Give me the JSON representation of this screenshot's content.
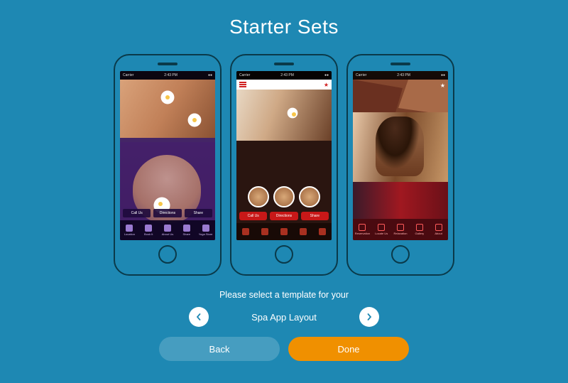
{
  "title": "Starter Sets",
  "instruction": "Please select a template for your",
  "templateName": "Spa App Layout",
  "buttons": {
    "back": "Back",
    "done": "Done"
  },
  "status": {
    "carrier": "Carrier",
    "time": "2:43 PM"
  },
  "phone1": {
    "actions": [
      "Call Us",
      "Directions",
      "Share"
    ],
    "tabs": [
      "Location",
      "Book It",
      "About Us",
      "Share",
      "Yoga Store"
    ]
  },
  "phone2": {
    "actions": [
      "Call Us",
      "Directions",
      "Share"
    ]
  },
  "phone3": {
    "tabs": [
      "Reservation",
      "Locate Us",
      "Relaxation",
      "Gallery",
      "About"
    ]
  }
}
